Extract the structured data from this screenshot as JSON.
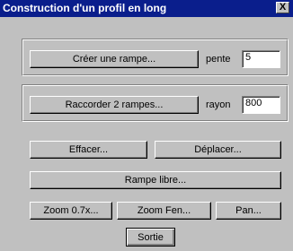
{
  "window": {
    "title": "Construction d'un profil en long",
    "close_label": "X"
  },
  "rampe": {
    "button_label": "Créer une rampe...",
    "field_label": "pente",
    "field_value": "5"
  },
  "raccord": {
    "button_label": "Raccorder 2 rampes...",
    "field_label": "rayon",
    "field_value": "800"
  },
  "actions": {
    "effacer_label": "Effacer...",
    "deplacer_label": "Déplacer...",
    "rampe_libre_label": "Rampe libre...",
    "zoom_07_label": "Zoom 0.7x...",
    "zoom_fen_label": "Zoom Fen...",
    "pan_label": "Pan...",
    "sortie_label": "Sortie"
  }
}
